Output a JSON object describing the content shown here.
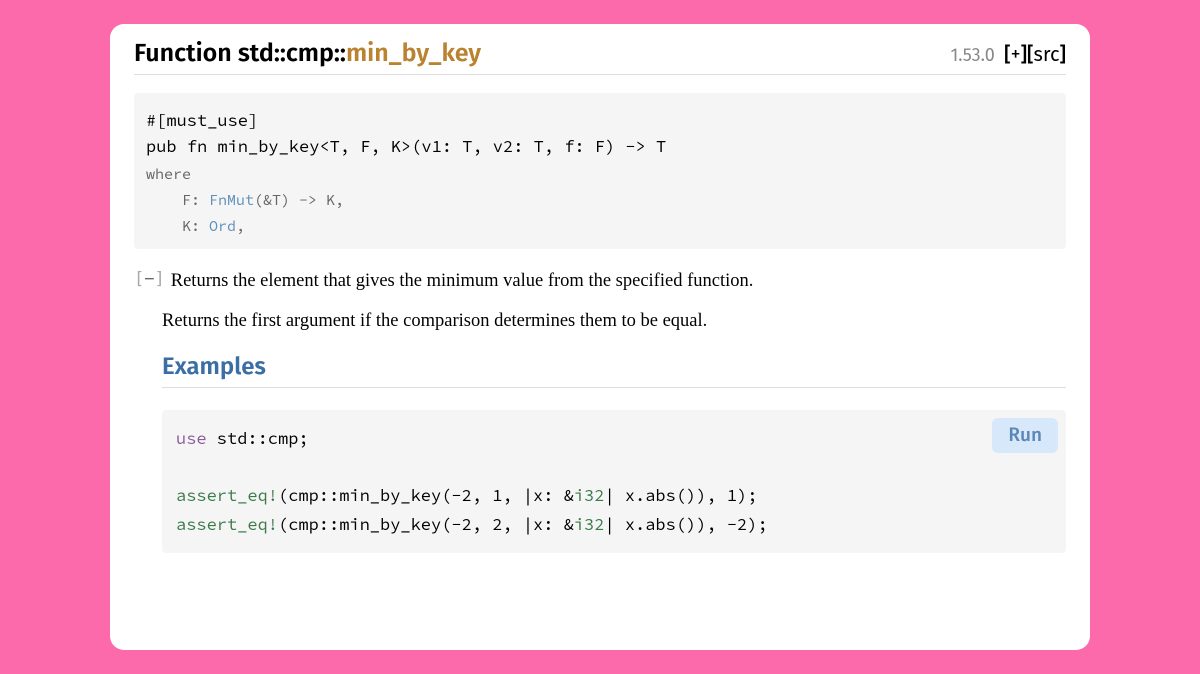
{
  "header": {
    "prefix": "Function ",
    "ns1": "std",
    "sep": "::",
    "ns2": "cmp",
    "fn": "min_by_key",
    "version": "1.53.0",
    "expand": "+",
    "src": "src"
  },
  "signature": {
    "line1": "#[must_use]",
    "line2": "pub fn min_by_key<T, F, K>(v1: T, v2: T, f: F) -> T",
    "where_kw": "where",
    "c1_pre": "    F: ",
    "c1_trait": "FnMut",
    "c1_post": "(&T) -> K,",
    "c2_pre": "    K: ",
    "c2_trait": "Ord",
    "c2_post": ","
  },
  "collapse": {
    "open": "[",
    "sym": "−",
    "close": "]"
  },
  "desc": {
    "p1": "Returns the element that gives the minimum value from the specified function.",
    "p2": "Returns the first argument if the comparison determines them to be equal."
  },
  "examples_heading": "Examples",
  "run_label": "Run",
  "code": {
    "kw_use": "use",
    "use_rest": " std::cmp;",
    "macro": "assert_eq!",
    "l1_a": "(cmp::min_by_key(-",
    "l1_n1": "2",
    "l1_b": ", ",
    "l1_n2": "1",
    "l1_c": ", |x: &",
    "l1_ty": "i32",
    "l1_d": "| x.abs()), ",
    "l1_n3": "1",
    "l1_e": ");",
    "l2_a": "(cmp::min_by_key(-",
    "l2_n1": "2",
    "l2_b": ", ",
    "l2_n2": "2",
    "l2_c": ", |x: &",
    "l2_ty": "i32",
    "l2_d": "| x.abs()), -",
    "l2_n3": "2",
    "l2_e": ");"
  }
}
